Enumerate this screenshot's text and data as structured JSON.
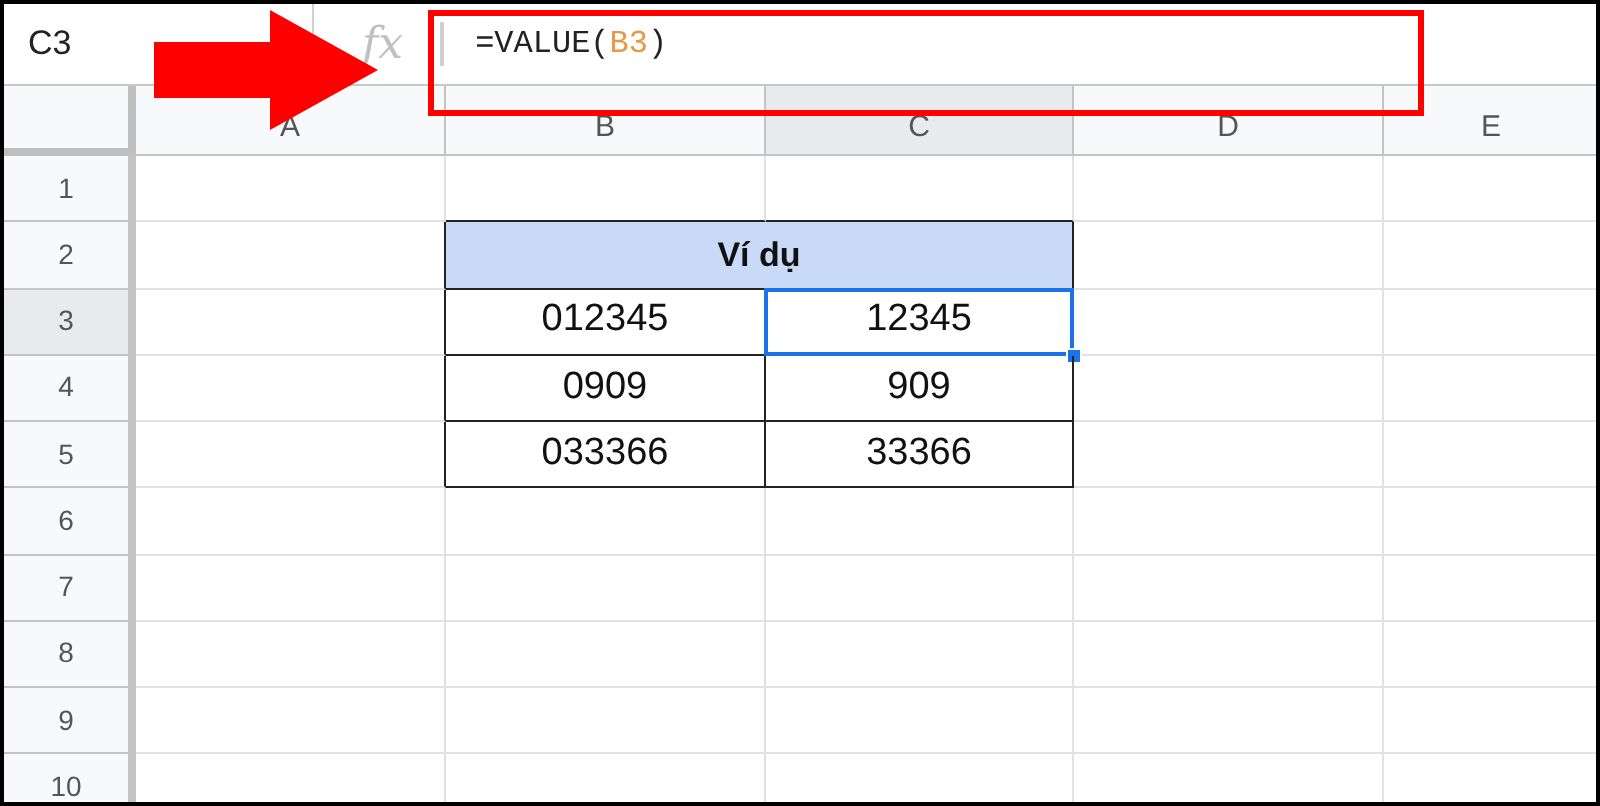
{
  "name_box": "C3",
  "formula_bar": {
    "icon_label": "fx",
    "segments": [
      {
        "text": "=VALUE(",
        "kind": "plain"
      },
      {
        "text": "B3",
        "kind": "reference"
      },
      {
        "text": ")",
        "kind": "plain"
      }
    ]
  },
  "columns": [
    {
      "label": "A",
      "selected": false
    },
    {
      "label": "B",
      "selected": false
    },
    {
      "label": "C",
      "selected": true
    },
    {
      "label": "D",
      "selected": false
    },
    {
      "label": "E",
      "selected": false
    }
  ],
  "rows": [
    {
      "label": "1",
      "selected": false
    },
    {
      "label": "2",
      "selected": false
    },
    {
      "label": "3",
      "selected": true
    },
    {
      "label": "4",
      "selected": false
    },
    {
      "label": "5",
      "selected": false
    },
    {
      "label": "6",
      "selected": false
    },
    {
      "label": "7",
      "selected": false
    },
    {
      "label": "8",
      "selected": false
    },
    {
      "label": "9",
      "selected": false
    },
    {
      "label": "10",
      "selected": false
    }
  ],
  "table": {
    "header": "Ví dụ",
    "rows": [
      [
        {
          "text": "012345",
          "selected": false
        },
        {
          "text": "12345",
          "selected": true
        }
      ],
      [
        {
          "text": "0909",
          "selected": false
        },
        {
          "text": "909",
          "selected": false
        }
      ],
      [
        {
          "text": "033366",
          "selected": false
        },
        {
          "text": "33366",
          "selected": false
        }
      ]
    ]
  }
}
